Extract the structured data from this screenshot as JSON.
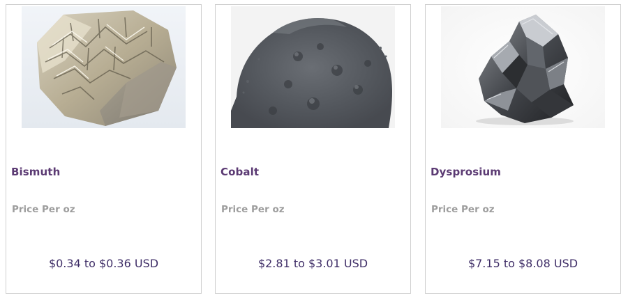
{
  "products": [
    {
      "name": "Bismuth",
      "unit_label": "Price Per oz",
      "price": "$0.34 to $0.36 USD",
      "image_icon": "bismuth-crystal-photo"
    },
    {
      "name": "Cobalt",
      "unit_label": "Price Per oz",
      "price": "$2.81 to $3.01 USD",
      "image_icon": "cobalt-powder-photo"
    },
    {
      "name": "Dysprosium",
      "unit_label": "Price Per oz",
      "price": "$7.15 to $8.08 USD",
      "image_icon": "dysprosium-chunk-photo"
    }
  ],
  "colors": {
    "name_text": "#5b3a73",
    "price_text": "#3f2e67",
    "unit_text": "#9d9d9d",
    "card_border": "#cfcfcf"
  }
}
